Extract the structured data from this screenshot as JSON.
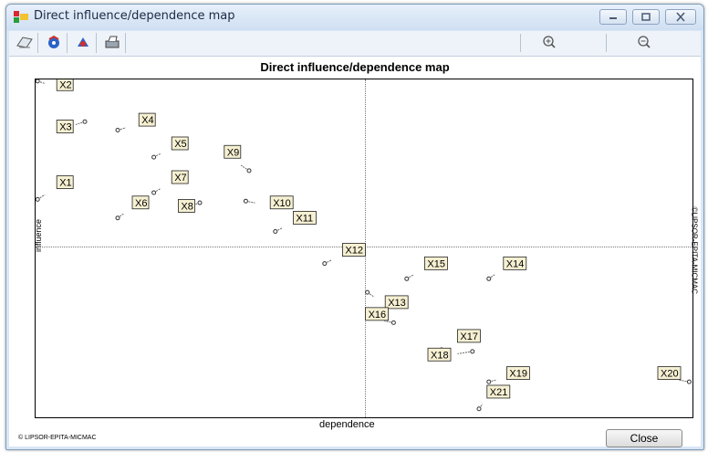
{
  "window": {
    "title": "Direct influence/dependence map"
  },
  "toolbar": {
    "zoom_in_icon": "zoom-in-icon",
    "zoom_out_icon": "zoom-out-icon"
  },
  "footer": {
    "credit": "© LIPSOR-EPITA-MICMAC",
    "close_label": "Close"
  },
  "chart_data": {
    "type": "scatter",
    "title": "Direct influence/dependence map",
    "xlabel": "dependence",
    "ylabel": "influence",
    "side_credit": "©LIPSOR-EPITA-MICMAC",
    "xlim": [
      0,
      100
    ],
    "ylim": [
      0,
      100
    ],
    "grid": "dotted quadrant lines",
    "points": [
      {
        "label": "X1",
        "x": 0.3,
        "y": 64.5,
        "lx": 3.5,
        "ly": 68.5
      },
      {
        "label": "X2",
        "x": 0.3,
        "y": 99.5,
        "lx": 3.5,
        "ly": 97.5
      },
      {
        "label": "X3",
        "x": 7.5,
        "y": 87.5,
        "lx": 3.5,
        "ly": 85.0
      },
      {
        "label": "X4",
        "x": 12.5,
        "y": 85.0,
        "lx": 16.0,
        "ly": 87.0
      },
      {
        "label": "X5",
        "x": 18.0,
        "y": 77.0,
        "lx": 21.0,
        "ly": 80.0
      },
      {
        "label": "X6",
        "x": 12.5,
        "y": 59.0,
        "lx": 15.0,
        "ly": 62.5
      },
      {
        "label": "X7",
        "x": 18.0,
        "y": 66.5,
        "lx": 21.0,
        "ly": 70.0
      },
      {
        "label": "X8",
        "x": 25.0,
        "y": 63.5,
        "lx": 22.0,
        "ly": 61.5
      },
      {
        "label": "X9",
        "x": 32.5,
        "y": 73.0,
        "lx": 29.0,
        "ly": 77.5
      },
      {
        "label": "X10",
        "x": 32.0,
        "y": 64.0,
        "lx": 36.0,
        "ly": 62.5
      },
      {
        "label": "X11",
        "x": 36.5,
        "y": 55.0,
        "lx": 39.5,
        "ly": 58.0
      },
      {
        "label": "X12",
        "x": 44.0,
        "y": 45.5,
        "lx": 47.0,
        "ly": 48.5
      },
      {
        "label": "X13",
        "x": 50.5,
        "y": 37.0,
        "lx": 53.5,
        "ly": 33.0
      },
      {
        "label": "X14",
        "x": 69.0,
        "y": 41.0,
        "lx": 71.5,
        "ly": 44.5
      },
      {
        "label": "X15",
        "x": 56.5,
        "y": 41.0,
        "lx": 59.5,
        "ly": 44.5
      },
      {
        "label": "X16",
        "x": 54.5,
        "y": 28.0,
        "lx": 50.5,
        "ly": 29.5
      },
      {
        "label": "X17",
        "x": 60.5,
        "y": 19.5,
        "lx": 64.5,
        "ly": 23.0
      },
      {
        "label": "X18",
        "x": 66.5,
        "y": 19.5,
        "lx": 60.0,
        "ly": 17.5
      },
      {
        "label": "X19",
        "x": 69.0,
        "y": 10.5,
        "lx": 72.0,
        "ly": 12.0
      },
      {
        "label": "X20",
        "x": 99.5,
        "y": 10.5,
        "lx": 95.0,
        "ly": 12.0
      },
      {
        "label": "X21",
        "x": 67.5,
        "y": 2.5,
        "lx": 69.0,
        "ly": 6.5
      }
    ]
  }
}
